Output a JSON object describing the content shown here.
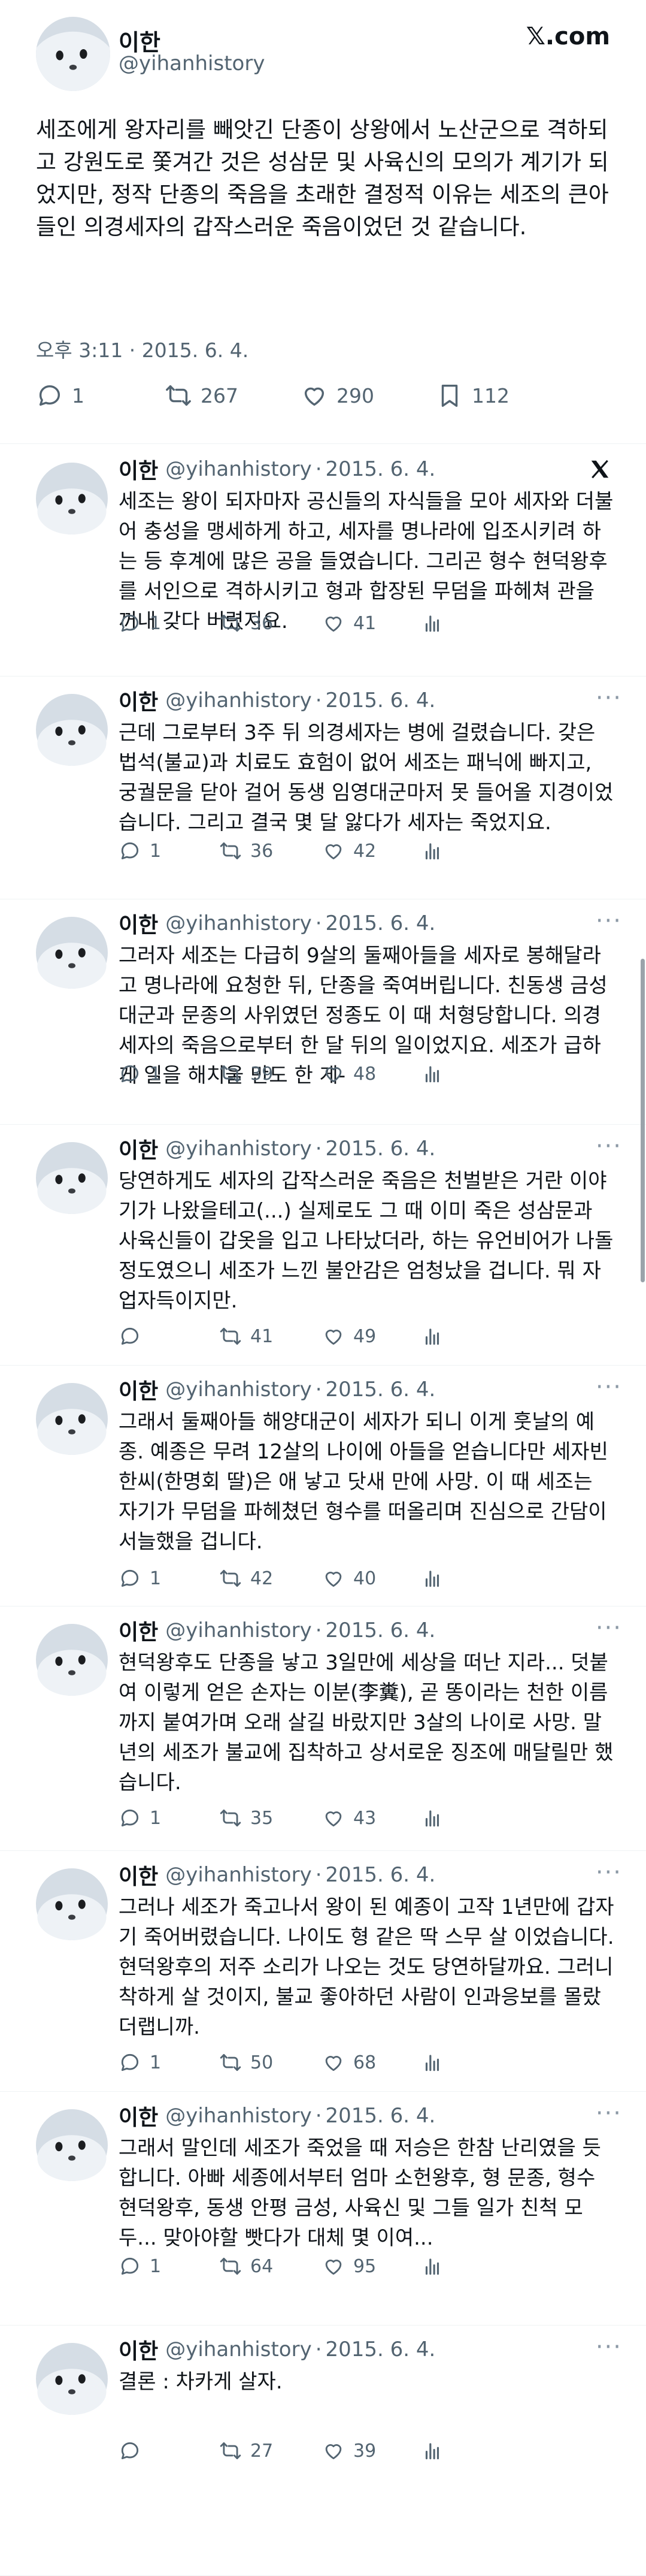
{
  "main": {
    "name": "이한",
    "handle": "@yihanhistory",
    "brand": "𝕏.com",
    "text": "세조에게 왕자리를 빼앗긴 단종이 상왕에서 노산군으로 격하되고 강원도로 쫓겨간 것은 성삼문 및 사육신의 모의가 계기가 되었지만, 정작 단종의 죽음을 초래한 결정적 이유는 세조의 큰아들인 의경세자의 갑작스러운 죽음이었던 것 같습니다.",
    "time": "오후 3:11 · 2015. 6. 4.",
    "replies": "1",
    "retweets": "267",
    "likes": "290",
    "bookmarks": "112"
  },
  "replies": [
    {
      "name": "이한",
      "handle": "@yihanhistory",
      "dot": "·",
      "date": "2015. 6. 4.",
      "text": "세조는 왕이 되자마자 공신들의 자식들을 모아 세자와 더불어 충성을 맹세하게 하고, 세자를 명나라에 입조시키려 하는 등 후계에 많은 공을 들였습니다. 그리곤 형수 현덕왕후를 서인으로 격하시키고 형과 합장된 무덤을 파헤쳐 관을 꺼내 갖다 버렸지요.",
      "replies": "1",
      "retweets": "36",
      "likes": "41"
    },
    {
      "name": "이한",
      "handle": "@yihanhistory",
      "dot": "·",
      "date": "2015. 6. 4.",
      "text": "근데 그로부터 3주 뒤 의경세자는 병에 걸렸습니다. 갖은 법석(불교)과 치료도 효험이 없어 세조는 패닉에 빠지고, 궁궐문을 닫아 걸어 동생 임영대군마저 못 들어올 지경이었습니다. 그리고 결국 몇 달 앓다가 세자는 죽었지요.",
      "replies": "1",
      "retweets": "36",
      "likes": "42"
    },
    {
      "name": "이한",
      "handle": "@yihanhistory",
      "dot": "·",
      "date": "2015. 6. 4.",
      "text": "그러자 세조는 다급히 9살의 둘째아들을 세자로 봉해달라고 명나라에 요청한 뒤, 단종을 죽여버립니다. 친동생 금성대군과 문종의 사위였던 정종도 이 때 처형당합니다. 의경세자의 죽음으로부터 한 달 뒤의 일이었지요. 세조가 급하게 일을 해치울 만도 한 게-",
      "replies": "1",
      "retweets": "39",
      "likes": "48"
    },
    {
      "name": "이한",
      "handle": "@yihanhistory",
      "dot": "·",
      "date": "2015. 6. 4.",
      "text": "당연하게도 세자의 갑작스러운 죽음은 천벌받은 거란 이야기가 나왔을테고(...) 실제로도 그 때 이미 죽은 성삼문과 사육신들이 갑옷을 입고 나타났더라, 하는 유언비어가 나돌 정도였으니 세조가 느낀 불안감은 엄청났을 겁니다. 뭐 자업자득이지만.",
      "replies": "",
      "retweets": "41",
      "likes": "49"
    },
    {
      "name": "이한",
      "handle": "@yihanhistory",
      "dot": "·",
      "date": "2015. 6. 4.",
      "text": "그래서 둘째아들 해양대군이 세자가 되니 이게 훗날의 예종. 예종은 무려 12살의 나이에 아들을 얻습니다만 세자빈 한씨(한명회 딸)은 애 낳고 닷새 만에 사망. 이 때 세조는 자기가 무덤을 파헤쳤던 형수를 떠올리며 진심으로 간담이 서늘했을 겁니다.",
      "replies": "1",
      "retweets": "42",
      "likes": "40"
    },
    {
      "name": "이한",
      "handle": "@yihanhistory",
      "dot": "·",
      "date": "2015. 6. 4.",
      "text": "현덕왕후도 단종을 낳고 3일만에 세상을 떠난 지라... 덧붙여 이렇게 얻은 손자는 이분(李糞), 곧 똥이라는 천한 이름까지 붙여가며 오래 살길 바랐지만 3살의 나이로 사망. 말년의 세조가 불교에 집착하고 상서로운 징조에 매달릴만 했습니다.",
      "replies": "1",
      "retweets": "35",
      "likes": "43"
    },
    {
      "name": "이한",
      "handle": "@yihanhistory",
      "dot": "·",
      "date": "2015. 6. 4.",
      "text": "그러나 세조가 죽고나서 왕이 된 예종이 고작 1년만에 갑자기 죽어버렸습니다. 나이도 형 같은 딱 스무 살 이었습니다. 현덕왕후의 저주 소리가 나오는 것도 당연하달까요. 그러니 착하게 살 것이지, 불교 좋아하던 사람이 인과응보를 몰랐더랩니까.",
      "replies": "1",
      "retweets": "50",
      "likes": "68"
    },
    {
      "name": "이한",
      "handle": "@yihanhistory",
      "dot": "·",
      "date": "2015. 6. 4.",
      "text": "그래서 말인데 세조가 죽었을 때 저승은 한참 난리였을 듯 합니다. 아빠 세종에서부터 엄마 소헌왕후, 형 문종, 형수 현덕왕후, 동생 안평 금성, 사육신 및 그들 일가 친척 모두... 맞아야할 빳다가 대체 몇 이여...",
      "replies": "1",
      "retweets": "64",
      "likes": "95"
    },
    {
      "name": "이한",
      "handle": "@yihanhistory",
      "dot": "·",
      "date": "2015. 6. 4.",
      "text": "결론 : 차카게 살자.",
      "replies": "",
      "retweets": "27",
      "likes": "39"
    }
  ],
  "icons": {
    "reply": "speech-bubble-icon",
    "retweet": "retweet-arrows-icon",
    "like": "heart-icon",
    "bookmark": "bookmark-icon",
    "views": "bar-chart-icon",
    "more": "more-dots-icon",
    "brand": "x-logo-icon"
  },
  "colors": {
    "text": "#0f1419",
    "secondary": "#536471",
    "divider": "#eff3f4"
  }
}
